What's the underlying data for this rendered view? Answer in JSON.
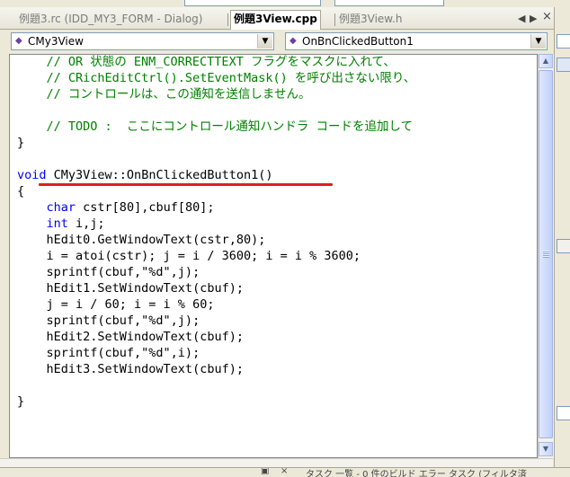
{
  "tabs": [
    {
      "label": "例題3.rc (IDD_MY3_FORM - Dialog)",
      "active": false
    },
    {
      "label": "例題3View.cpp",
      "active": true
    },
    {
      "label": "例題3View.h",
      "active": false
    }
  ],
  "tab_controls": {
    "scroll_left": "◀",
    "scroll_right": "▶",
    "close": "×"
  },
  "class_combo": {
    "value": "CMy3View",
    "icon": "class-icon"
  },
  "member_combo": {
    "value": "OnBnClickedButton1",
    "icon": "method-icon"
  },
  "code": {
    "lines": [
      {
        "text": "    // OR 状態の ENM_CORRECTTEXT フラグをマスクに入れて、",
        "kind": "comment"
      },
      {
        "text": "    // CRichEditCtrl().SetEventMask() を呼び出さない限り、",
        "kind": "comment"
      },
      {
        "text": "    // コントロールは、この通知を送信しません。",
        "kind": "comment"
      },
      {
        "text": "",
        "kind": "plain"
      },
      {
        "text": "    // TODO :  ここにコントロール通知ハンドラ コードを追加して",
        "kind": "comment"
      },
      {
        "text": "}",
        "kind": "plain"
      },
      {
        "text": "",
        "kind": "plain"
      },
      {
        "text": "CMy3View::OnBnClickedButton1()",
        "kind": "void"
      },
      {
        "text": "{",
        "kind": "plain"
      },
      {
        "text": "cstr[80],cbuf[80];",
        "kind": "char"
      },
      {
        "text": "i,j;",
        "kind": "int"
      },
      {
        "text": "    hEdit0.GetWindowText(cstr,80);",
        "kind": "plain"
      },
      {
        "text": "    i = atoi(cstr); j = i / 3600; i = i % 3600;",
        "kind": "plain"
      },
      {
        "text": "    sprintf(cbuf,\"%d\",j);",
        "kind": "plain"
      },
      {
        "text": "    hEdit1.SetWindowText(cbuf);",
        "kind": "plain"
      },
      {
        "text": "    j = i / 60; i = i % 60;",
        "kind": "plain"
      },
      {
        "text": "    sprintf(cbuf,\"%d\",j);",
        "kind": "plain"
      },
      {
        "text": "    hEdit2.SetWindowText(cbuf);",
        "kind": "plain"
      },
      {
        "text": "    sprintf(cbuf,\"%d\",i);",
        "kind": "plain"
      },
      {
        "text": "    hEdit3.SetWindowText(cbuf);",
        "kind": "plain"
      },
      {
        "text": "",
        "kind": "plain"
      },
      {
        "text": "}",
        "kind": "plain"
      }
    ],
    "keywords": {
      "void": "void",
      "char": "char",
      "int": "int"
    }
  },
  "bottom_strip": {
    "text": "タスク  一覧 - 0 件のビルド エラー タスク (フィルタ済"
  },
  "colors": {
    "comment": "#008000",
    "keyword": "#0000ff",
    "annotation_underline": "#e0201b",
    "editor_bg": "#ffffff",
    "chrome_bg": "#ece9d8"
  }
}
